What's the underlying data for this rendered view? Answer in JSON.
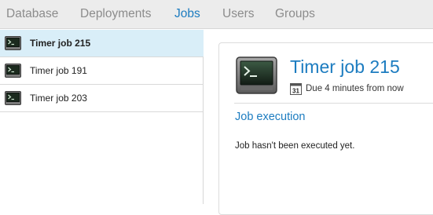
{
  "nav": {
    "tabs": [
      {
        "label": "Database"
      },
      {
        "label": "Deployments"
      },
      {
        "label": "Jobs"
      },
      {
        "label": "Users"
      },
      {
        "label": "Groups"
      }
    ],
    "active_tab": "Jobs"
  },
  "jobs_list": {
    "items": [
      {
        "label": "Timer job 215",
        "selected": true,
        "icon": "terminal-icon"
      },
      {
        "label": "Timer job 191",
        "selected": false,
        "icon": "terminal-icon"
      },
      {
        "label": "Timer job 203",
        "selected": false,
        "icon": "terminal-icon"
      }
    ]
  },
  "detail": {
    "title": "Timer job 215",
    "icon": "terminal-icon",
    "due_icon": "calendar-icon",
    "due_icon_text": "31",
    "due_text": "Due 4 minutes from now",
    "section_title": "Job execution",
    "message": "Job hasn't been executed yet."
  },
  "colors": {
    "accent": "#1c7cc0",
    "selected_row": "#d9eef8",
    "nav_bg": "#ececec",
    "nav_inactive": "#8c8c8c"
  }
}
